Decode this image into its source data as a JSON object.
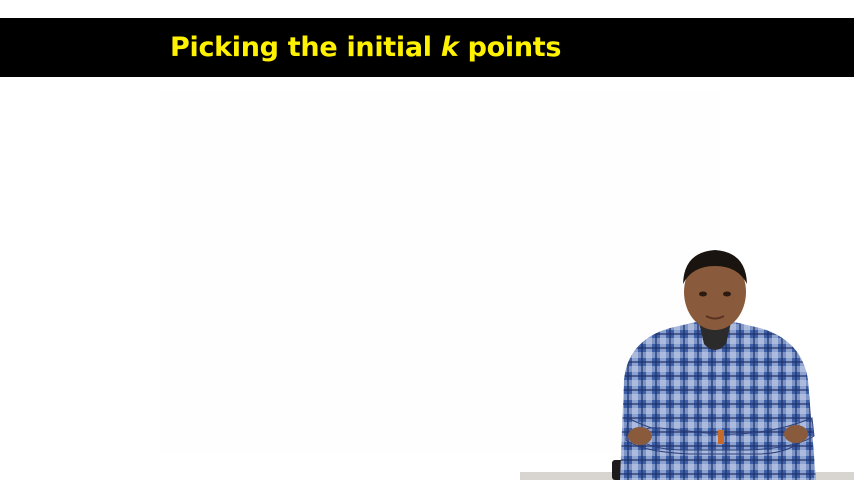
{
  "slide": {
    "title_prefix": "Picking the initial ",
    "title_variable": "k",
    "title_suffix": " points"
  },
  "colors": {
    "title_bar": "#000000",
    "title_text": "#fff200",
    "background": "#ffffff",
    "shirt_blue": "#3d5fa8",
    "shirt_check": "#cfd8ee",
    "skin": "#8a5a3c"
  },
  "presenter": {
    "icon": "presenter-person",
    "posture": "arms-crossed"
  }
}
